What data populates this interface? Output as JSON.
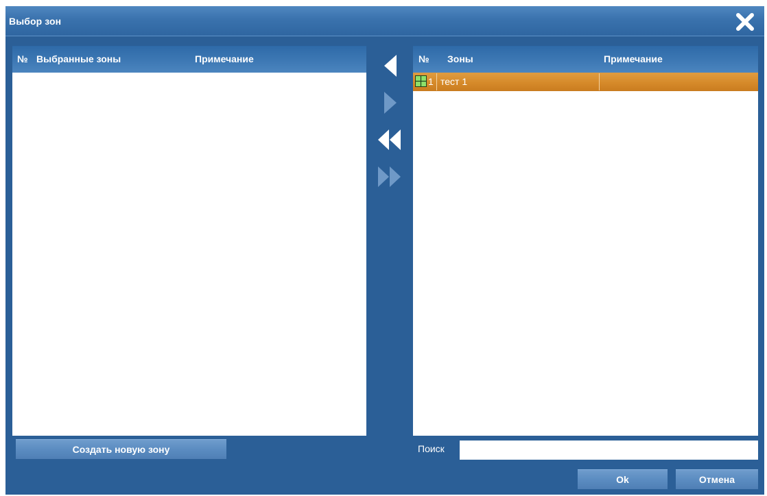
{
  "dialog": {
    "title": "Выбор зон"
  },
  "left_panel": {
    "columns": [
      "№",
      "Выбранные зоны",
      "Примечание"
    ],
    "rows": []
  },
  "right_panel": {
    "columns": [
      "№",
      "Зоны",
      "Примечание"
    ],
    "rows": [
      {
        "num": "1",
        "name": "тест 1",
        "note": "",
        "selected": true,
        "icon": "zone-grid-icon"
      }
    ]
  },
  "transfer": {
    "move_left": "arrow-left-icon",
    "move_right": "arrow-right-icon",
    "move_all_left": "double-arrow-left-icon",
    "move_all_right": "double-arrow-right-icon"
  },
  "actions": {
    "create_zone": "Создать новую зону",
    "search_label": "Поиск",
    "search_value": "",
    "ok": "Ok",
    "cancel": "Отмена"
  },
  "colors": {
    "background": "#2b5f97",
    "header": "#3d78b4",
    "selection": "#d68a2a",
    "button": "#5b8cc1"
  }
}
